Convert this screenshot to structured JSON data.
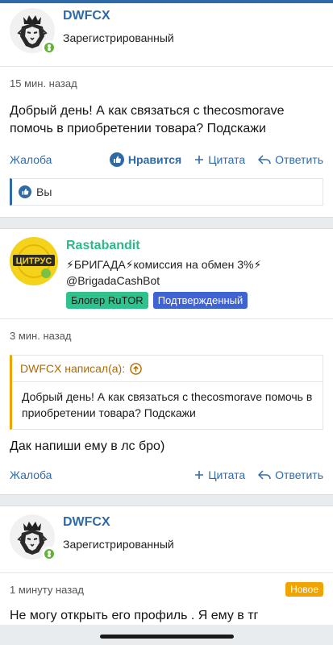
{
  "posts": [
    {
      "username": "DWFCX",
      "user_title": "Зарегистрированный",
      "time": "15 мин. назад",
      "text": "Добрый день! А как связаться с thecosmorave помочь в приобретении товара? Подскажи",
      "actions": {
        "report": "Жалоба",
        "like": "Нравится",
        "quote": "Цитата",
        "reply": "Ответить"
      },
      "likes_text": "Вы"
    },
    {
      "username": "Rastabandit",
      "avatar_text": "ЦИТРУС",
      "user_title": "⚡БРИГАДА⚡комиссия на обмен 3%⚡ @BrigadaCashBot",
      "badges": [
        "Блогер RuTOR",
        "Подтвержденный"
      ],
      "time": "3 мин. назад",
      "quote": {
        "author": "DWFCX написал(а):",
        "text": "Добрый день! А как связаться с thecosmorave помочь в приобретении товара? Подскажи"
      },
      "text": "Дак напиши ему в лс бро)",
      "actions": {
        "report": "Жалоба",
        "quote": "Цитата",
        "reply": "Ответить"
      }
    },
    {
      "username": "DWFCX",
      "user_title": "Зарегистрированный",
      "time": "1 минуту назад",
      "new_label": "Новое",
      "text": "Не могу открыть его профиль . Я ему в тг"
    }
  ],
  "colors": {
    "link": "#2f6aa8",
    "accent_green": "#2fb789",
    "new": "#f0a400"
  },
  "icons": [
    "lion-avatar",
    "online-indicator",
    "thumbs-up-icon",
    "plus-icon",
    "reply-icon",
    "arrow-up-circle-icon"
  ]
}
